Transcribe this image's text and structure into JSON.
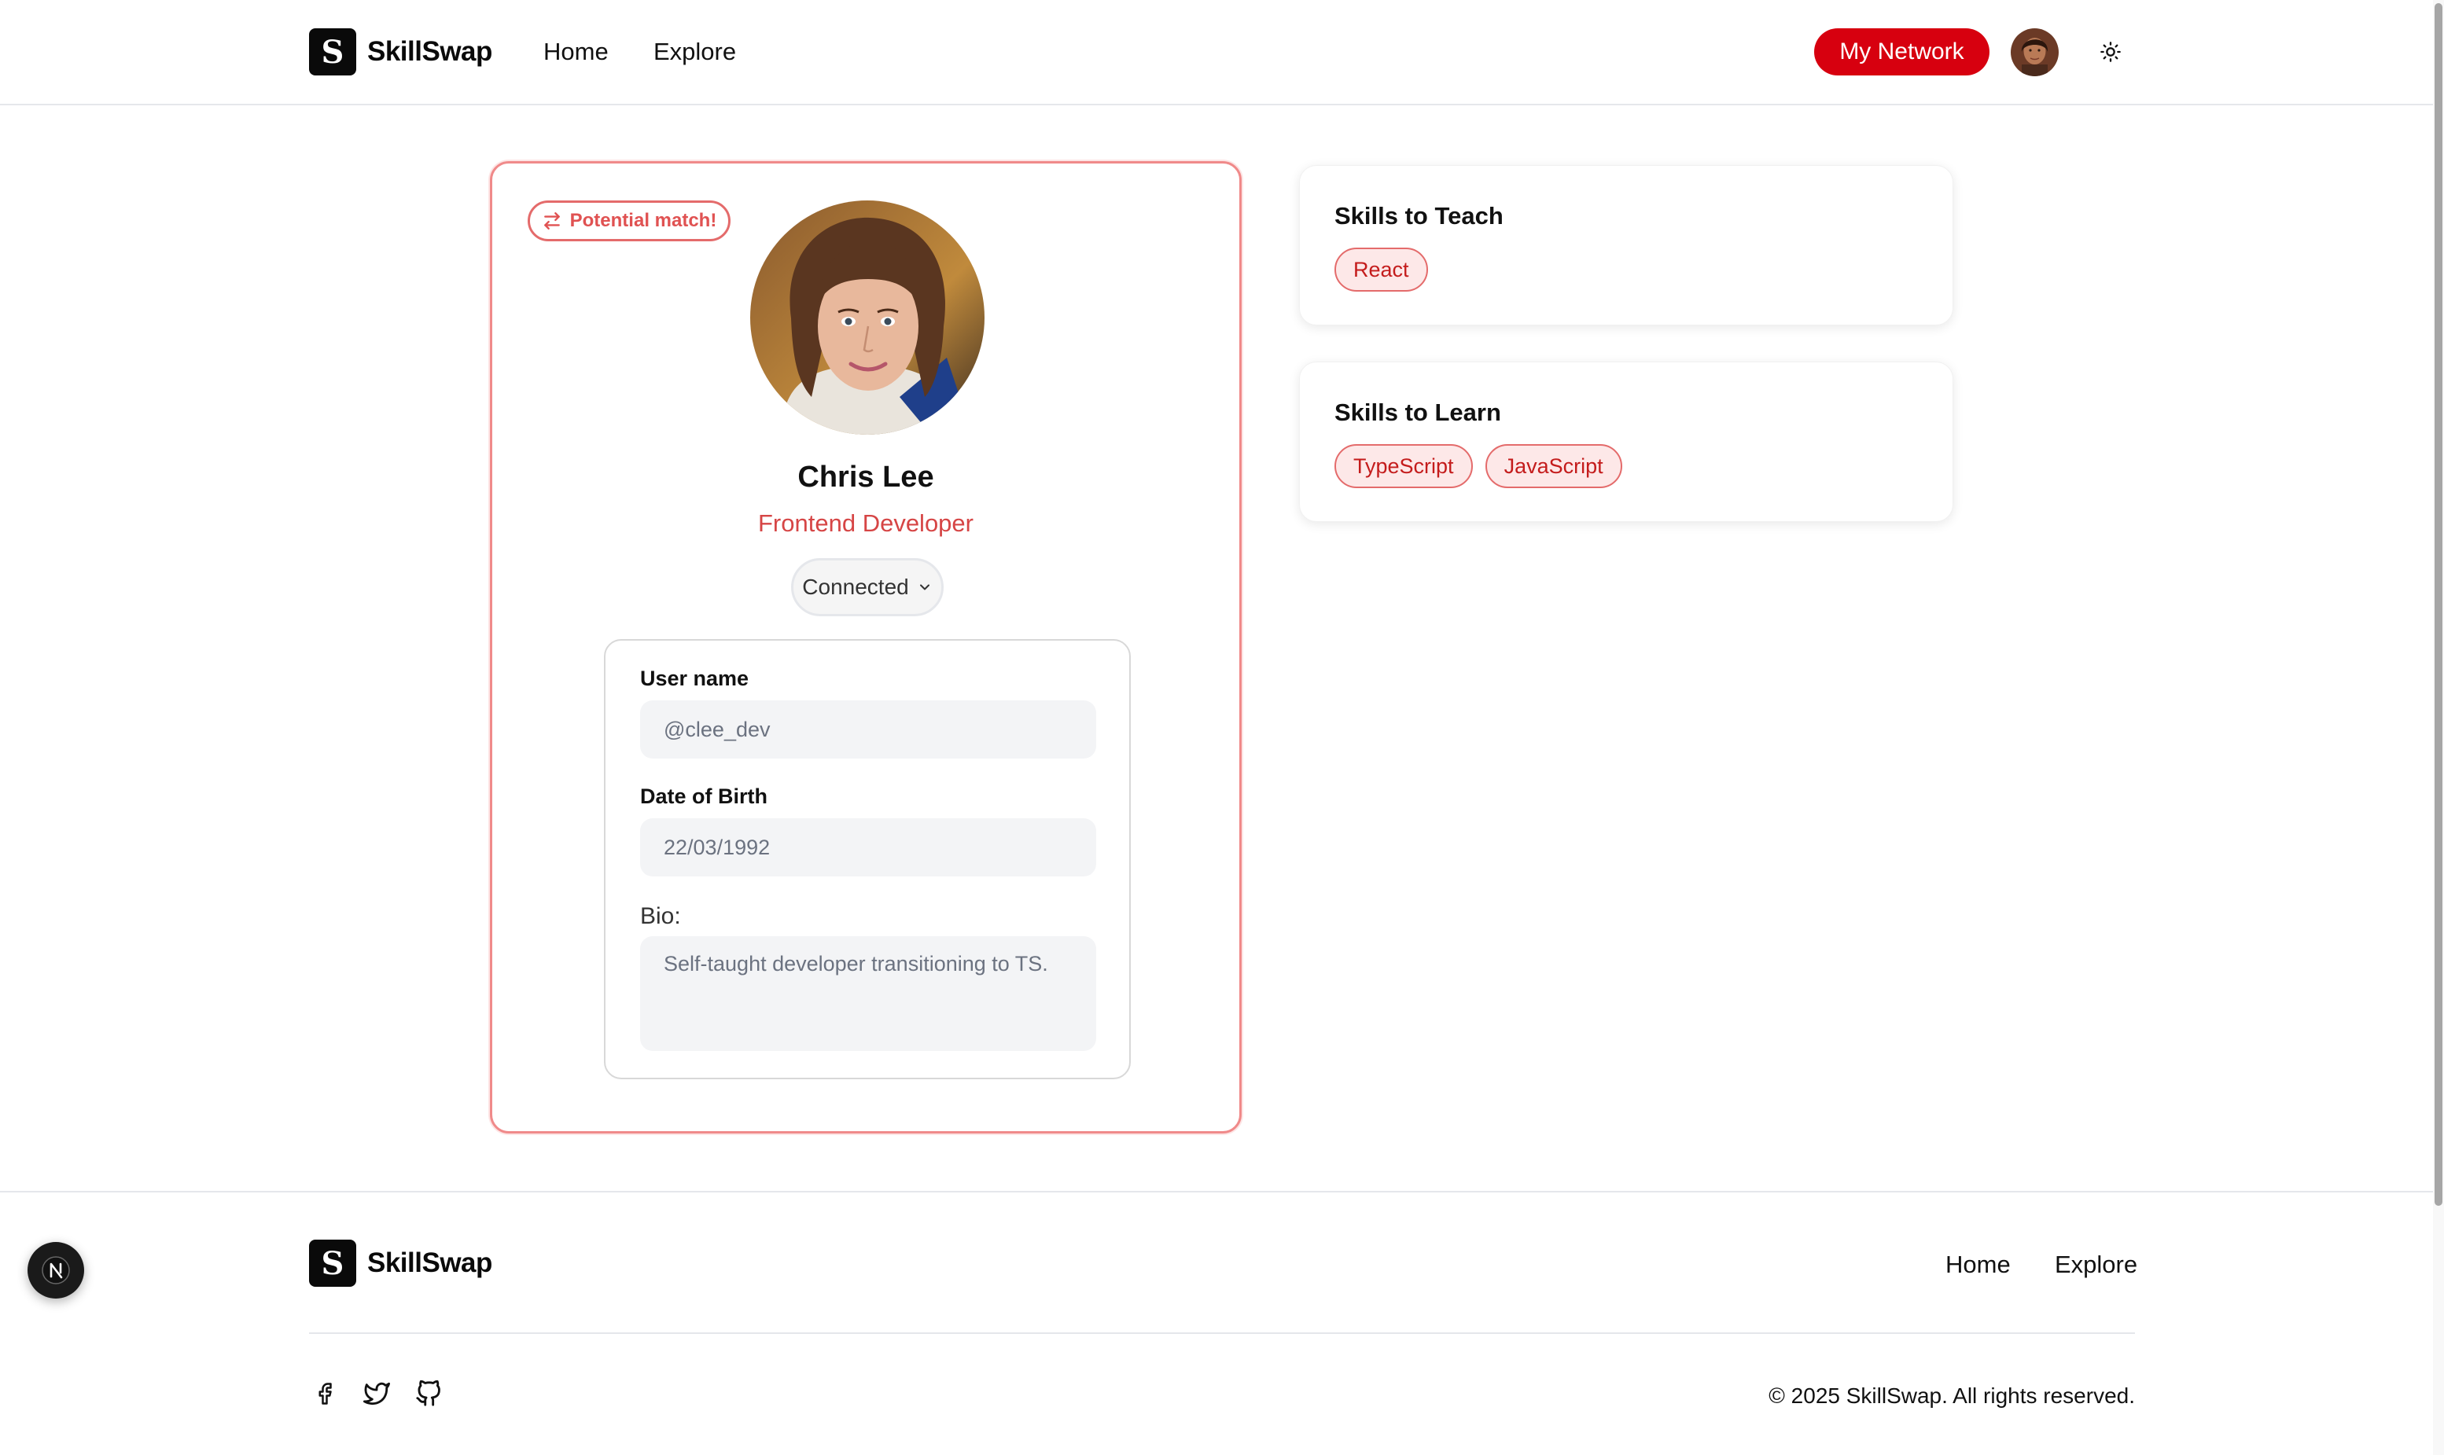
{
  "brand": {
    "logo_letter": "S",
    "name": "SkillSwap"
  },
  "nav": {
    "home": "Home",
    "explore": "Explore",
    "my_network": "My Network"
  },
  "profile": {
    "badge": "Potential match!",
    "name": "Chris Lee",
    "role": "Frontend Developer",
    "status": "Connected",
    "fields": {
      "username_label": "User name",
      "username_value": "@clee_dev",
      "dob_label": "Date of Birth",
      "dob_value": "22/03/1992",
      "bio_label": "Bio:",
      "bio_value": "Self-taught developer transitioning to TS."
    }
  },
  "skills_teach": {
    "title": "Skills to Teach",
    "items": [
      "React"
    ]
  },
  "skills_learn": {
    "title": "Skills to Learn",
    "items": [
      "TypeScript",
      "JavaScript"
    ]
  },
  "footer": {
    "home": "Home",
    "explore": "Explore",
    "copyright": "© 2025 SkillSwap. All rights reserved.",
    "social_icons": [
      "facebook-icon",
      "twitter-icon",
      "github-icon"
    ]
  },
  "dev_badge_letter": "N",
  "colors": {
    "accent": "#d7000f",
    "accent_soft": "#fde8e8",
    "chip_text": "#c41c1c",
    "role_text": "#d64545"
  }
}
